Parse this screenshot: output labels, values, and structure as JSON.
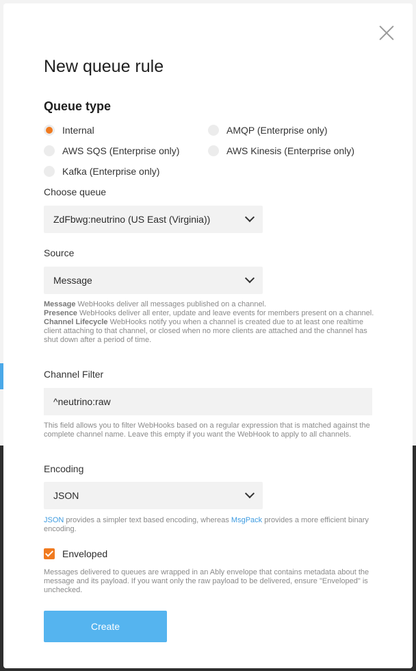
{
  "modal": {
    "title": "New queue rule",
    "queue_type_heading": "Queue type",
    "queue_types": [
      {
        "label": "Internal",
        "checked": true
      },
      {
        "label": "AMQP (Enterprise only)",
        "checked": false
      },
      {
        "label": "AWS SQS (Enterprise only)",
        "checked": false
      },
      {
        "label": "AWS Kinesis (Enterprise only)",
        "checked": false
      },
      {
        "label": "Kafka (Enterprise only)",
        "checked": false
      }
    ],
    "choose_queue": {
      "label": "Choose queue",
      "value": "ZdFbwg:neutrino (US East (Virginia))"
    },
    "source": {
      "label": "Source",
      "value": "Message",
      "help": [
        {
          "term": "Message",
          "text": " WebHooks deliver all messages published on a channel."
        },
        {
          "term": "Presence",
          "text": " WebHooks deliver all enter, update and leave events for members present on a channel."
        },
        {
          "term": "Channel Lifecycle",
          "text": " WebHooks notify you when a channel is created due to at least one realtime client attaching to that channel, or closed when no more clients are attached and the channel has shut down after a period of time."
        }
      ]
    },
    "channel_filter": {
      "label": "Channel Filter",
      "value": "^neutrino:raw",
      "help": "This field allows you to filter WebHooks based on a regular expression that is matched against the complete channel name. Leave this empty if you want the WebHook to apply to all channels."
    },
    "encoding": {
      "label": "Encoding",
      "value": "JSON",
      "help_link1": "JSON",
      "help_mid": " provides a simpler text based encoding, whereas ",
      "help_link2": "MsgPack",
      "help_end": " provides a more efficient binary encoding."
    },
    "enveloped": {
      "label": "Enveloped",
      "checked": true,
      "help": "Messages delivered to queues are wrapped in an Ably envelope that contains metadata about the message and its payload. If you want only the raw payload to be delivered, ensure \"Enveloped\" is unchecked."
    },
    "create_label": "Create"
  },
  "colors": {
    "accent": "#f07a1f",
    "button": "#55b4ef",
    "link": "#3d9be0"
  }
}
